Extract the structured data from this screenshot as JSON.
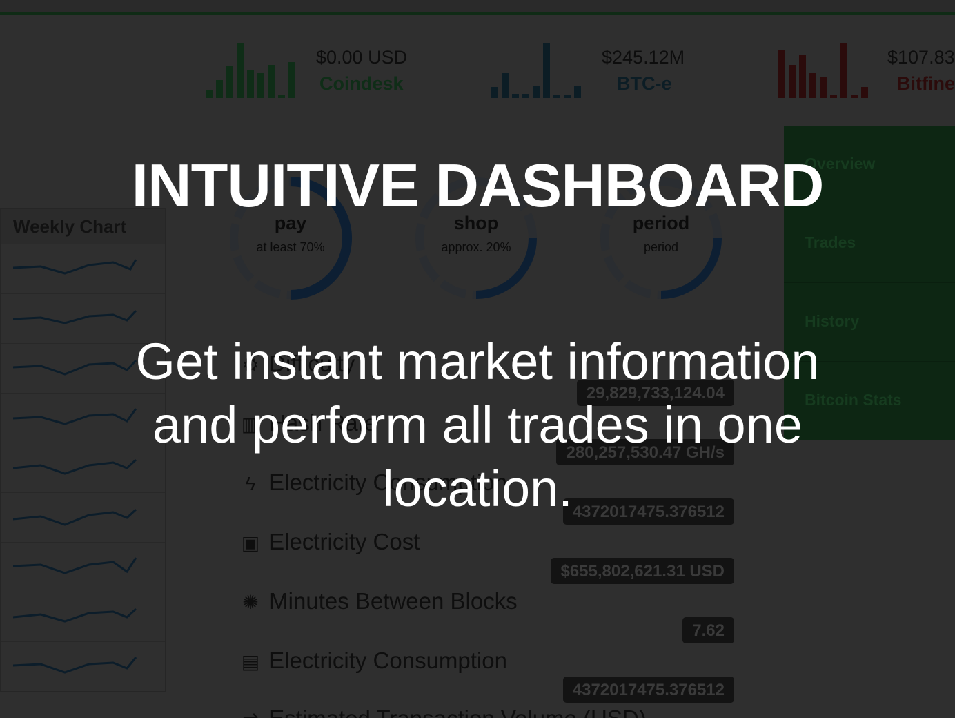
{
  "overlay": {
    "headline": "INTUITIVE DASHBOARD",
    "subheadline": "Get instant market information and perform all trades in one location."
  },
  "tickers": [
    {
      "price": "$0.00 USD",
      "exchange": "Coindesk",
      "color": "#0f2d17"
    },
    {
      "price": "$245.12M",
      "exchange": "BTC-e",
      "color": "#0c1d25"
    },
    {
      "price": "$107.83",
      "exchange": "Bitfine",
      "color": "#2b0b0b"
    }
  ],
  "sidebar": {
    "items": [
      {
        "label": "Overview"
      },
      {
        "label": "Trades"
      },
      {
        "label": "History"
      },
      {
        "label": "Bitcoin Stats"
      }
    ]
  },
  "weekly_chart": {
    "title": "Weekly Chart"
  },
  "donuts": [
    {
      "title": "pay",
      "subtitle": "at least 70%",
      "percent": 70
    },
    {
      "title": "shop",
      "subtitle": "approx. 20%",
      "percent": 20
    },
    {
      "title": "period",
      "subtitle": "period",
      "percent": 25
    }
  ],
  "stats": [
    {
      "label": "Difficulty",
      "value": "29,829,733,124.04",
      "icon": "gear-icon"
    },
    {
      "label": "Hash Rate",
      "value": "280,257,530.47 GH/s",
      "icon": "barcode-icon"
    },
    {
      "label": "Electricity Consumption",
      "value": "4372017475.376512",
      "icon": "bolt-icon"
    },
    {
      "label": "Electricity Cost",
      "value": "$655,802,621.31 USD",
      "icon": "money-icon"
    },
    {
      "label": "Minutes Between Blocks",
      "value": "7.62",
      "icon": "spinner-icon"
    },
    {
      "label": "Electricity Consumption",
      "value": "4372017475.376512",
      "icon": "save-icon"
    },
    {
      "label": "Estimated Transaction Volume (USD)",
      "value": "",
      "icon": "transfer-icon"
    }
  ]
}
